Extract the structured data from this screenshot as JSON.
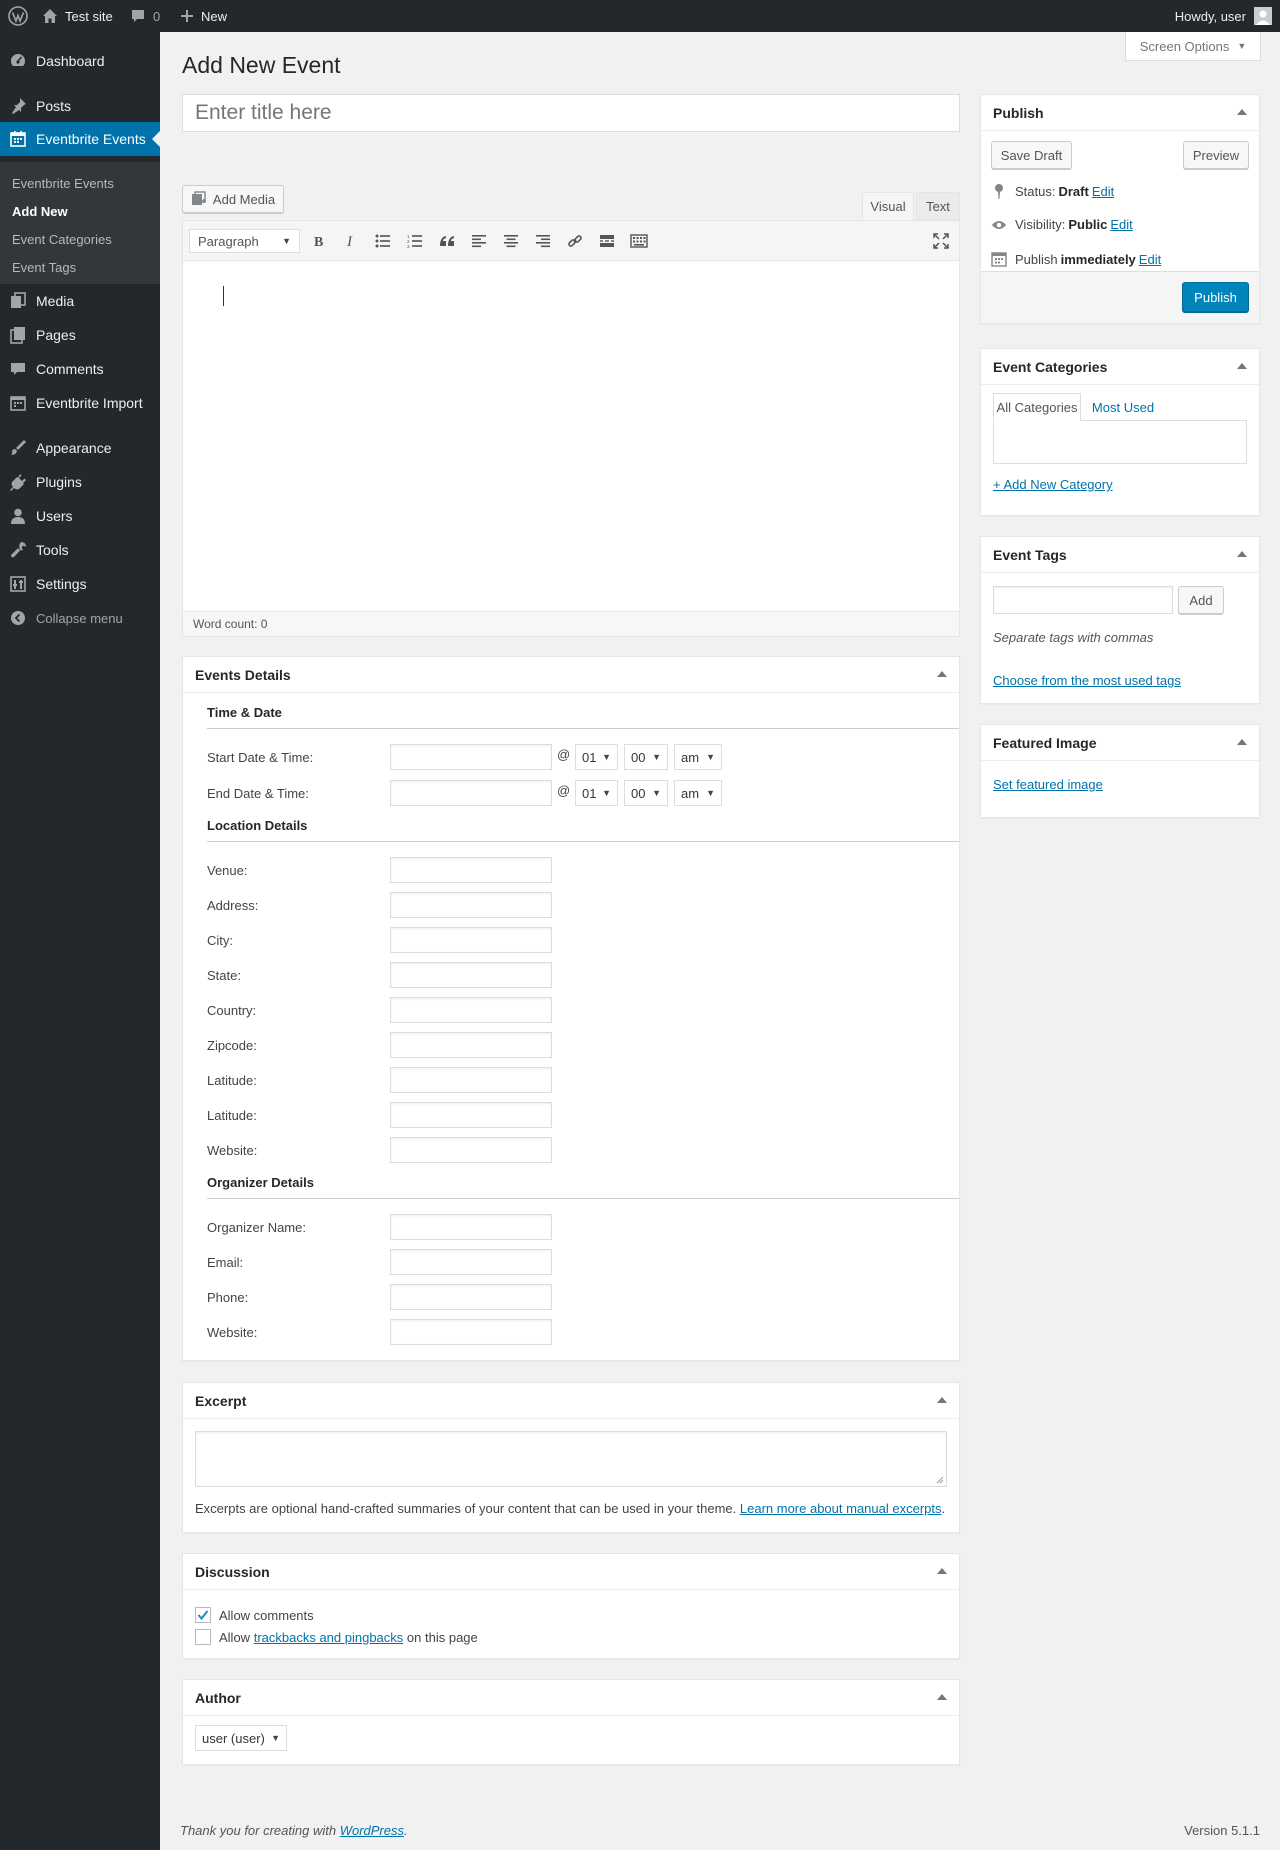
{
  "adminbar": {
    "site_name": "Test site",
    "comments_count": "0",
    "new_label": "New",
    "howdy": "Howdy, user"
  },
  "sidebar": {
    "items": [
      {
        "label": "Dashboard",
        "icon": "dashboard-icon"
      },
      {
        "label": "Posts",
        "icon": "pin-icon"
      },
      {
        "label": "Eventbrite Events",
        "icon": "calendar-icon"
      },
      {
        "label": "Media",
        "icon": "media-icon"
      },
      {
        "label": "Pages",
        "icon": "pages-icon"
      },
      {
        "label": "Comments",
        "icon": "comment-icon"
      },
      {
        "label": "Eventbrite Import",
        "icon": "calendar-icon"
      },
      {
        "label": "Appearance",
        "icon": "brush-icon"
      },
      {
        "label": "Plugins",
        "icon": "plug-icon"
      },
      {
        "label": "Users",
        "icon": "user-icon"
      },
      {
        "label": "Tools",
        "icon": "wrench-icon"
      },
      {
        "label": "Settings",
        "icon": "settings-icon"
      }
    ],
    "submenu": [
      "Eventbrite Events",
      "Add New",
      "Event Categories",
      "Event Tags"
    ],
    "collapse_label": "Collapse menu"
  },
  "page": {
    "title": "Add New Event",
    "screen_options": "Screen Options",
    "title_placeholder": "Enter title here"
  },
  "editor": {
    "add_media": "Add Media",
    "tab_visual": "Visual",
    "tab_text": "Text",
    "format": "Paragraph",
    "word_count": "Word count: 0"
  },
  "events_details": {
    "title": "Events Details",
    "time_date_title": "Time & Date",
    "start_label": "Start Date & Time:",
    "end_label": "End Date & Time:",
    "at": "@",
    "hour": "01",
    "minute": "00",
    "ampm": "am",
    "location_title": "Location Details",
    "location_fields": [
      "Venue:",
      "Address:",
      "City:",
      "State:",
      "Country:",
      "Zipcode:",
      "Latitude:",
      "Latitude:",
      "Website:"
    ],
    "organizer_title": "Organizer Details",
    "organizer_fields": [
      "Organizer Name:",
      "Email:",
      "Phone:",
      "Website:"
    ]
  },
  "excerpt": {
    "title": "Excerpt",
    "help": "Excerpts are optional hand-crafted summaries of your content that can be used in your theme.",
    "link": "Learn more about manual excerpts",
    "period": "."
  },
  "discussion": {
    "title": "Discussion",
    "allow_comments": "Allow comments",
    "allow_prefix": "Allow",
    "trackbacks_link": "trackbacks and pingbacks",
    "allow_suffix": "on this page"
  },
  "author": {
    "title": "Author",
    "selected": "user (user)"
  },
  "publish": {
    "title": "Publish",
    "save_draft": "Save Draft",
    "preview": "Preview",
    "status_label": "Status:",
    "status_value": "Draft",
    "visibility_label": "Visibility:",
    "visibility_value": "Public",
    "publish_label": "Publish",
    "publish_value": "immediately",
    "edit": "Edit",
    "publish_button": "Publish"
  },
  "categories": {
    "title": "Event Categories",
    "tab_all": "All Categories",
    "tab_most": "Most Used",
    "add_new": "+ Add New Category"
  },
  "tags": {
    "title": "Event Tags",
    "add": "Add",
    "help": "Separate tags with commas",
    "choose": "Choose from the most used tags"
  },
  "featured": {
    "title": "Featured Image",
    "set": "Set featured image"
  },
  "footer": {
    "thanks": "Thank you for creating with",
    "wp_link": "WordPress",
    "period": ".",
    "version": "Version 5.1.1"
  },
  "colors": {
    "accent": "#0073aa",
    "sidebar_bg": "#23282d",
    "primary_button": "#0085ba"
  }
}
